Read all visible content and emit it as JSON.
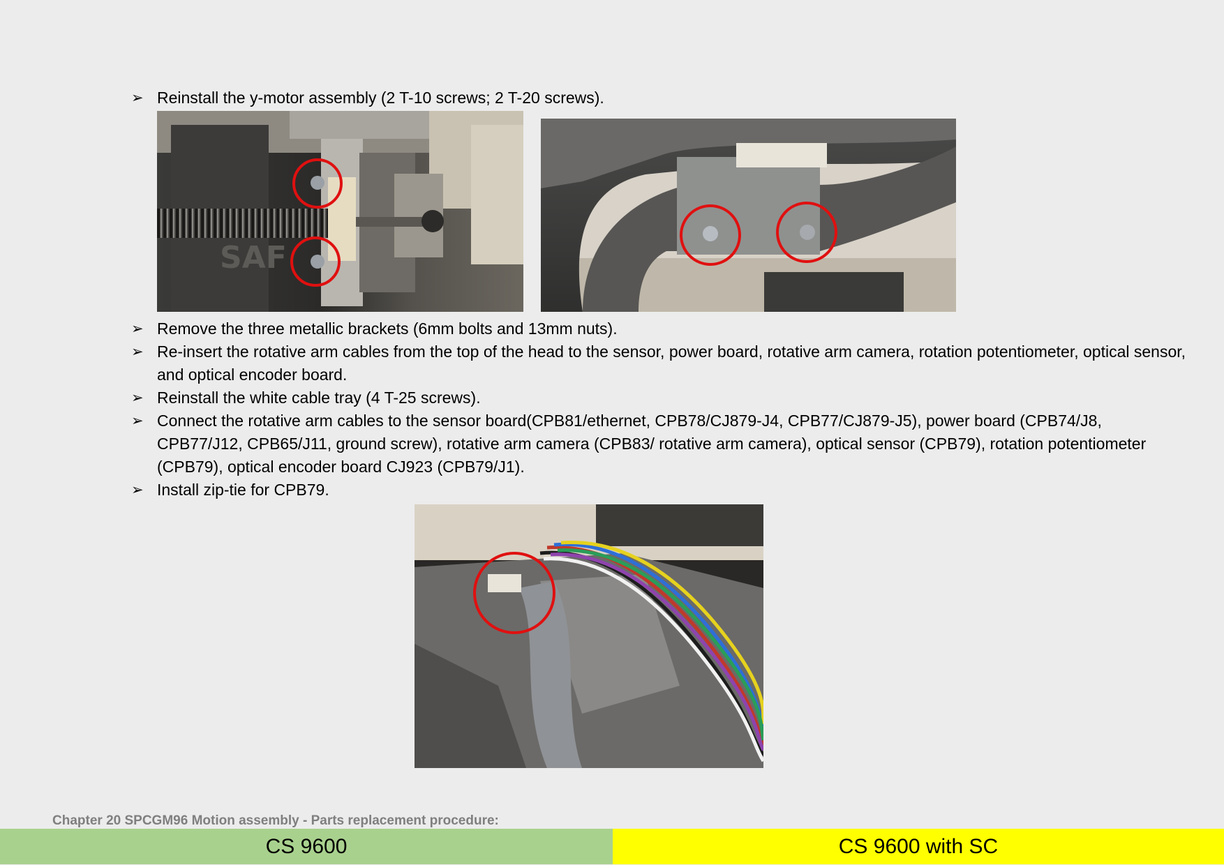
{
  "bullets": [
    {
      "marker": "➢",
      "text": "Reinstall the y-motor assembly (2 T-10 screws; 2 T-20 screws)."
    },
    {
      "marker": "➢",
      "text": "Remove the three metallic brackets (6mm bolts and 13mm nuts)."
    },
    {
      "marker": "➢",
      "text": "Re-insert the rotative arm cables from the top of the head to the sensor, power board, rotative arm camera, rotation potentiometer, optical sensor, and optical encoder board."
    },
    {
      "marker": "➢",
      "text": "Reinstall the white cable tray (4 T-25 screws)."
    },
    {
      "marker": "➢",
      "text": "Connect the rotative arm cables to the sensor board(CPB81/ethernet, CPB78/CJ879-J4, CPB77/CJ879-J5), power board (CPB74/J8, CPB77/J12, CPB65/J11, ground screw), rotative arm camera (CPB83/ rotative arm camera), optical sensor (CPB79), rotation potentiometer (CPB79), optical encoder board CJ923 (CPB79/J1)."
    },
    {
      "marker": "➢",
      "text": "Install zip-tie for CPB79."
    }
  ],
  "footer": {
    "chapter": "Chapter 20 SPCGM96 Motion assembly - Parts replacement procedure:",
    "left_band": "CS 9600",
    "right_band": "CS 9600 with SC"
  },
  "colors": {
    "highlight_circle": "#e01010",
    "band_left": "#a9d18e",
    "band_right": "#ffff00",
    "background": "#ececec"
  }
}
